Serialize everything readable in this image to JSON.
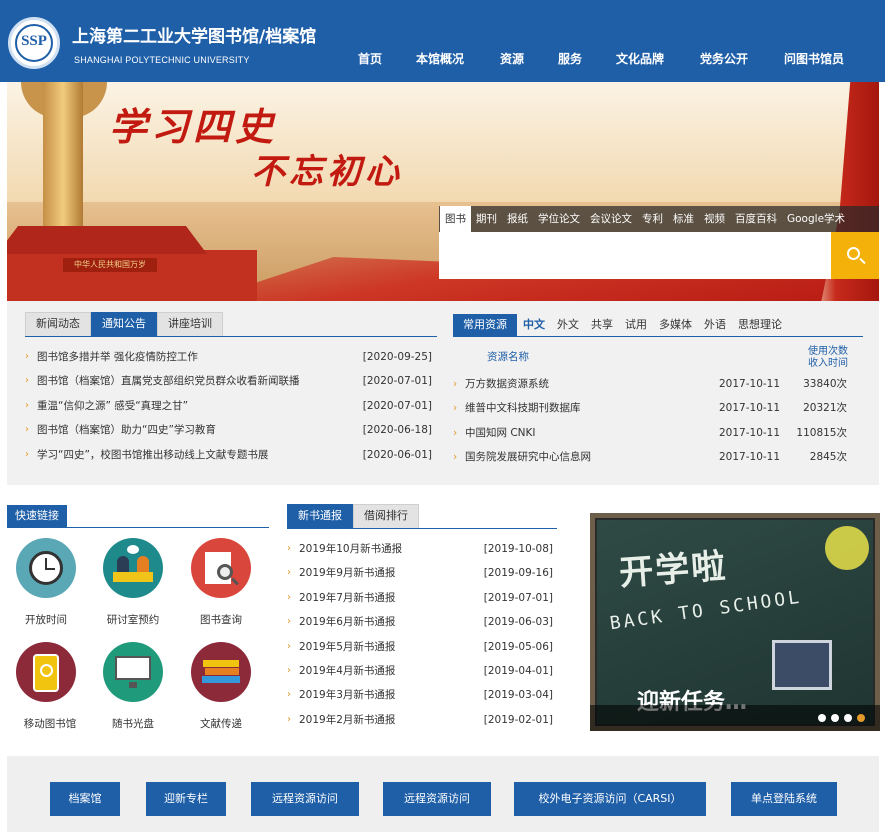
{
  "header": {
    "logo_text": "SSP",
    "title_cn": "上海第二工业大学图书馆/档案馆",
    "title_en": "SHANGHAI POLYTECHNIC UNIVERSITY",
    "nav": [
      "首页",
      "本馆概况",
      "资源",
      "服务",
      "文化品牌",
      "党务公开",
      "问图书馆员"
    ]
  },
  "banner": {
    "slogan_line1": "学习四史",
    "slogan_line2": "不忘初心",
    "gate_plaque": "中华人民共和国万岁"
  },
  "search": {
    "tabs": [
      "图书",
      "期刊",
      "报纸",
      "学位论文",
      "会议论文",
      "专利",
      "标准",
      "视频",
      "百度百科",
      "Google学术"
    ],
    "active_tab": "图书",
    "input_value": "",
    "placeholder": ""
  },
  "news": {
    "tabs": [
      "新闻动态",
      "通知公告",
      "讲座培训"
    ],
    "active_tab": "通知公告",
    "items": [
      {
        "title": "图书馆多措并举 强化疫情防控工作",
        "date": "[2020-09-25]"
      },
      {
        "title": "图书馆（档案馆）直属党支部组织党员群众收看新闻联播",
        "date": "[2020-07-01]"
      },
      {
        "title": "重温“信仰之源” 感受“真理之甘”",
        "date": "[2020-07-01]"
      },
      {
        "title": "图书馆（档案馆）助力“四史”学习教育",
        "date": "[2020-06-18]"
      },
      {
        "title": "学习“四史”，校图书馆推出移动线上文献专题书展",
        "date": "[2020-06-01]"
      }
    ]
  },
  "resources": {
    "tabs": [
      "常用资源",
      "中文",
      "外文",
      "共享",
      "试用",
      "多媒体",
      "外语",
      "思想理论"
    ],
    "active_tab": "常用资源",
    "current_subtab": "中文",
    "col_name": "资源名称",
    "col_usage": "使用次数",
    "col_time": "收入时间",
    "items": [
      {
        "name": "万方数据资源系统",
        "date": "2017-10-11",
        "count": "33840次"
      },
      {
        "name": "维普中文科技期刊数据库",
        "date": "2017-10-11",
        "count": "20321次"
      },
      {
        "name": "中国知网 CNKI",
        "date": "2017-10-11",
        "count": "110815次"
      },
      {
        "name": "国务院发展研究中心信息网",
        "date": "2017-10-11",
        "count": "2845次"
      }
    ]
  },
  "quick_links": {
    "title": "快速链接",
    "items": [
      {
        "label": "开放时间",
        "icon": "clock-icon",
        "color": "#5aa7b5"
      },
      {
        "label": "研讨室预约",
        "icon": "meeting-room-icon",
        "color": "#1f8a8c"
      },
      {
        "label": "图书查询",
        "icon": "book-search-icon",
        "color": "#d9463b"
      },
      {
        "label": "移动图书馆",
        "icon": "mobile-library-icon",
        "color": "#8c2a3a"
      },
      {
        "label": "随书光盘",
        "icon": "computer-disc-icon",
        "color": "#1f9a7a"
      },
      {
        "label": "文献传递",
        "icon": "books-stack-icon",
        "color": "#8c2a3a"
      }
    ]
  },
  "new_books": {
    "tabs": [
      "新书通报",
      "借阅排行"
    ],
    "active_tab": "新书通报",
    "items": [
      {
        "title": "2019年10月新书通报",
        "date": "[2019-10-08]"
      },
      {
        "title": "2019年9月新书通报",
        "date": "[2019-09-16]"
      },
      {
        "title": "2019年7月新书通报",
        "date": "[2019-07-01]"
      },
      {
        "title": "2019年6月新书通报",
        "date": "[2019-06-03]"
      },
      {
        "title": "2019年5月新书通报",
        "date": "[2019-05-06]"
      },
      {
        "title": "2019年4月新书通报",
        "date": "[2019-04-01]"
      },
      {
        "title": "2019年3月新书通报",
        "date": "[2019-03-04]"
      },
      {
        "title": "2019年2月新书通报",
        "date": "[2019-02-01]"
      }
    ]
  },
  "slideshow": {
    "headline": "开学啦",
    "subline": "BACK TO SCHOOL",
    "caption": "迎新任务…",
    "slide_count": 4,
    "active_slide": 4
  },
  "bottom_links": [
    "档案馆",
    "迎新专栏",
    "远程资源访问",
    "远程资源访问",
    "校外电子资源访问（CARSI）",
    "单点登陆系统"
  ],
  "colors": {
    "brand_blue": "#1f5fa8",
    "search_yellow": "#f3b10a",
    "bullet_orange": "#e39a2b"
  }
}
